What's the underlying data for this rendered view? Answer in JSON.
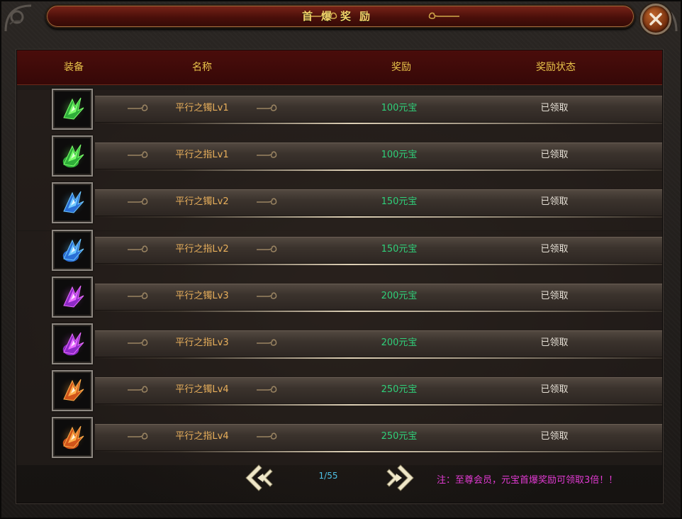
{
  "title": "首爆奖励",
  "table": {
    "headers": [
      "装备",
      "名称",
      "奖励",
      "奖励状态"
    ],
    "rows": [
      {
        "icon": "green-bracelet-icon",
        "name": "平行之镯Lv1",
        "reward": "100元宝",
        "status": "已领取"
      },
      {
        "icon": "green-ring-icon",
        "name": "平行之指Lv1",
        "reward": "100元宝",
        "status": "已领取"
      },
      {
        "icon": "blue-bracelet-icon",
        "name": "平行之镯Lv2",
        "reward": "150元宝",
        "status": "已领取"
      },
      {
        "icon": "blue-ring-icon",
        "name": "平行之指Lv2",
        "reward": "150元宝",
        "status": "已领取"
      },
      {
        "icon": "purple-bracelet-icon",
        "name": "平行之镯Lv3",
        "reward": "200元宝",
        "status": "已领取"
      },
      {
        "icon": "purple-ring-icon",
        "name": "平行之指Lv3",
        "reward": "200元宝",
        "status": "已领取"
      },
      {
        "icon": "orange-bracelet-icon",
        "name": "平行之镯Lv4",
        "reward": "250元宝",
        "status": "已领取"
      },
      {
        "icon": "orange-ring-icon",
        "name": "平行之指Lv4",
        "reward": "250元宝",
        "status": "已领取"
      }
    ]
  },
  "pager": {
    "page": "1/55",
    "prev_icon": "arrow-left-icon",
    "next_icon": "arrow-right-icon"
  },
  "note": "注：至尊会员，元宝首爆奖励可领取3倍！！",
  "colors": {
    "title": "#f3d36a",
    "header_text": "#e8c34a",
    "header_bg": "#4a0d0b",
    "item_name": "#e9b05c",
    "reward": "#2fd07a",
    "status": "#e6e0d6",
    "page_num": "#4fc3e8",
    "note": "#e23ad3"
  }
}
